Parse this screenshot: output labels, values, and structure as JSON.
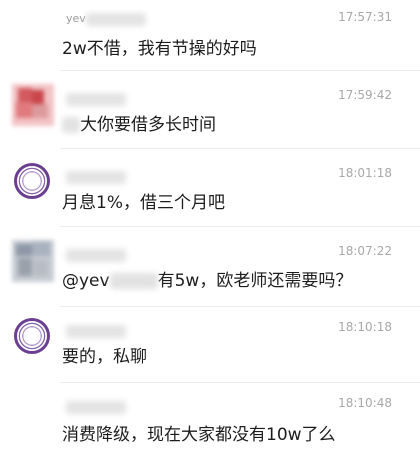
{
  "messages": [
    {
      "name": "yev",
      "time": "17:57:31",
      "text": "2w不借，我有节操的好吗"
    },
    {
      "name": "",
      "time": "17:59:42",
      "text": "大你要借多长时间"
    },
    {
      "name": "",
      "time": "18:01:18",
      "text": "月息1%，借三个月吧"
    },
    {
      "name": "",
      "time": "18:07:22",
      "text_prefix": "@yev",
      "text_suffix": "有5w，欧老师还需要吗？"
    },
    {
      "name": "",
      "time": "18:10:18",
      "text": "要的，私聊"
    },
    {
      "name": "",
      "time": "18:10:48",
      "text": "消费降级，现在大家都没有10w了么"
    }
  ],
  "avatars": [
    {
      "icon": "blurred-red-avatar-icon"
    },
    {
      "icon": "purple-ring-logo-icon"
    },
    {
      "icon": "blurred-gray-avatar-icon"
    },
    {
      "icon": "purple-ring-logo-icon"
    }
  ],
  "colors": {
    "background": "#ffffff",
    "text": "#1c1c1c",
    "meta": "#a8a8a8",
    "ring": "#6b3f8f"
  }
}
